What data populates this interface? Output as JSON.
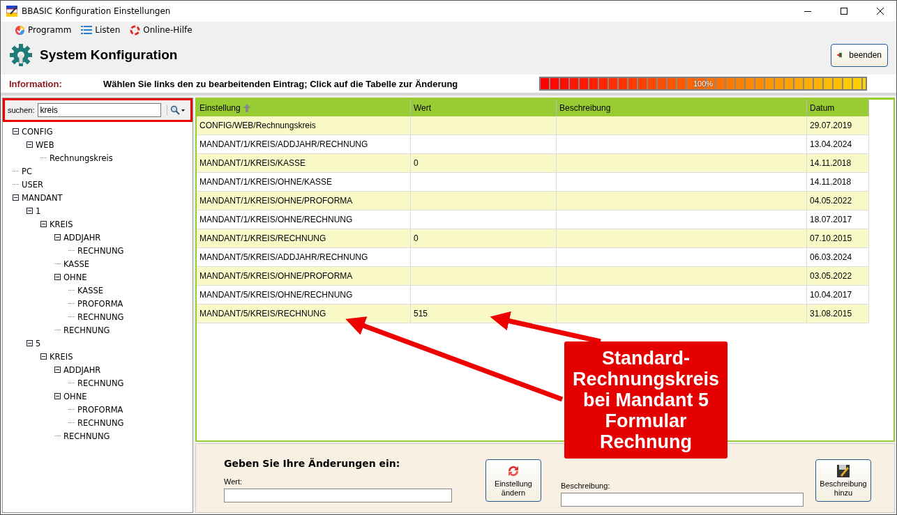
{
  "window": {
    "title": "BBASIC Konfiguration Einstellungen"
  },
  "menu": [
    {
      "label": "Programm"
    },
    {
      "label": "Listen"
    },
    {
      "label": "Online-Hilfe"
    }
  ],
  "header": {
    "title": "System Konfiguration",
    "exit_button": "beenden"
  },
  "info": {
    "label": "Information:",
    "text": "Wählen Sie links den zu bearbeitenden Eintrag; Click auf die Tabelle zur Änderung",
    "progress": {
      "level": 1,
      "reading": "100%"
    }
  },
  "search": {
    "label": "suchen:",
    "value": "kreis"
  },
  "tree": [
    {
      "label": "CONFIG",
      "expanded": true,
      "children": [
        {
          "label": "WEB",
          "expanded": true,
          "children": [
            {
              "label": "Rechnungskreis"
            }
          ]
        }
      ]
    },
    {
      "label": "PC"
    },
    {
      "label": "USER"
    },
    {
      "label": "MANDANT",
      "expanded": true,
      "children": [
        {
          "label": "1",
          "expanded": true,
          "children": [
            {
              "label": "KREIS",
              "expanded": true,
              "children": [
                {
                  "label": "ADDJAHR",
                  "expanded": true,
                  "children": [
                    {
                      "label": "RECHNUNG"
                    }
                  ]
                },
                {
                  "label": "KASSE"
                },
                {
                  "label": "OHNE",
                  "expanded": true,
                  "children": [
                    {
                      "label": "KASSE"
                    },
                    {
                      "label": "PROFORMA"
                    },
                    {
                      "label": "RECHNUNG"
                    }
                  ]
                },
                {
                  "label": "RECHNUNG"
                }
              ]
            }
          ]
        },
        {
          "label": "5",
          "expanded": true,
          "children": [
            {
              "label": "KREIS",
              "expanded": true,
              "children": [
                {
                  "label": "ADDJAHR",
                  "expanded": true,
                  "children": [
                    {
                      "label": "RECHNUNG"
                    }
                  ]
                },
                {
                  "label": "OHNE",
                  "expanded": true,
                  "children": [
                    {
                      "label": "PROFORMA"
                    },
                    {
                      "label": "RECHNUNG"
                    }
                  ]
                },
                {
                  "label": "RECHNUNG"
                }
              ]
            }
          ]
        }
      ]
    }
  ],
  "table": {
    "columns": [
      "Einstellung",
      "Wert",
      "Beschreibung",
      "Datum"
    ],
    "rows": [
      [
        "CONFIG/WEB/Rechnungskreis",
        "",
        "",
        "29.07.2019"
      ],
      [
        "MANDANT/1/KREIS/ADDJAHR/RECHNUNG",
        "",
        "",
        "13.04.2024"
      ],
      [
        "MANDANT/1/KREIS/KASSE",
        "0",
        "",
        "14.11.2018"
      ],
      [
        "MANDANT/1/KREIS/OHNE/KASSE",
        "",
        "",
        "14.11.2018"
      ],
      [
        "MANDANT/1/KREIS/OHNE/PROFORMA",
        "",
        "",
        "04.05.2022"
      ],
      [
        "MANDANT/1/KREIS/OHNE/RECHNUNG",
        "",
        "",
        "18.07.2017"
      ],
      [
        "MANDANT/1/KREIS/RECHNUNG",
        "0",
        "",
        "07.10.2015"
      ],
      [
        "MANDANT/5/KREIS/ADDJAHR/RECHNUNG",
        "",
        "",
        "06.03.2024"
      ],
      [
        "MANDANT/5/KREIS/OHNE/PROFORMA",
        "",
        "",
        "03.05.2022"
      ],
      [
        "MANDANT/5/KREIS/OHNE/RECHNUNG",
        "",
        "",
        "10.04.2017"
      ],
      [
        "MANDANT/5/KREIS/RECHNUNG",
        "515",
        "",
        "31.08.2015"
      ]
    ]
  },
  "edit": {
    "title": "Geben Sie Ihre Änderungen ein:",
    "value_label": "Wert:",
    "change_button": "Einstellung ändern",
    "description_label": "Beschreibung:",
    "add_button": "Beschreibung hinzu"
  },
  "annotation": {
    "text": "Standard-Rechnungskreis bei Mandant 5 Formular Rechnung"
  }
}
